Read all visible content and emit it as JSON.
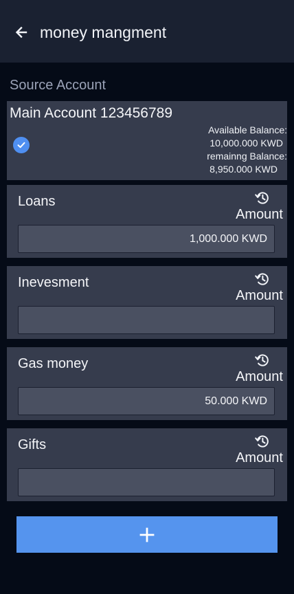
{
  "header": {
    "back_icon": "arrow-left-icon",
    "title": "money mangment"
  },
  "source": {
    "section_title": "Source Account",
    "account_name": "Main Account 123456789",
    "selected": true,
    "check_icon": "check-circle-icon",
    "available_label": "Available Balance:",
    "available_value": "10,000.000 KWD",
    "remaining_label": "remainng  Balance:",
    "remaining_value": "8,950.000 KWD"
  },
  "categories": [
    {
      "name": "Loans",
      "amount_label": "Amount",
      "amount_value": "1,000.000 KWD",
      "history_icon": "history-icon"
    },
    {
      "name": "Inevesment",
      "amount_label": "Amount",
      "amount_value": "",
      "history_icon": "history-icon"
    },
    {
      "name": "Gas money",
      "amount_label": "Amount",
      "amount_value": "50.000 KWD",
      "history_icon": "history-icon"
    },
    {
      "name": "Gifts",
      "amount_label": "Amount",
      "amount_value": "",
      "history_icon": "history-icon"
    }
  ],
  "add_button": {
    "icon": "plus-icon"
  },
  "colors": {
    "background": "#050b17",
    "app_bar": "#1a2131",
    "card": "#363c4d",
    "input": "#4a5061",
    "accent": "#5594ee",
    "muted_text": "#9ba3b8"
  }
}
